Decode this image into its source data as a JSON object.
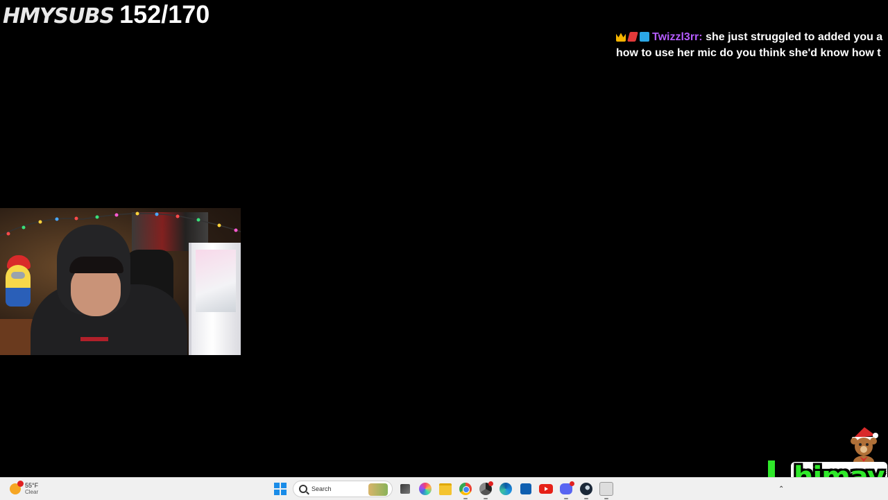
{
  "overlay": {
    "sub_goal_label": "HMYSUBS",
    "sub_goal_count": "152/170"
  },
  "chat": {
    "username": "Twizzl3rr:",
    "message_line1": "she just struggled to added you a",
    "message_line2": "how to use her mic do you think she'd know how t"
  },
  "brand": {
    "name": "himay"
  },
  "taskbar": {
    "weather_temp": "55°F",
    "weather_condition": "Clear",
    "search_placeholder": "Search",
    "apps": [
      "start",
      "search",
      "task-view",
      "copilot",
      "file-explorer",
      "chrome",
      "chrome-profile",
      "edge",
      "store",
      "youtube",
      "discord",
      "steam",
      "obs"
    ]
  },
  "colors": {
    "chat_username": "#b55cff",
    "brand_green": "#2fe82a",
    "taskbar_bg": "#f0f0f0"
  }
}
